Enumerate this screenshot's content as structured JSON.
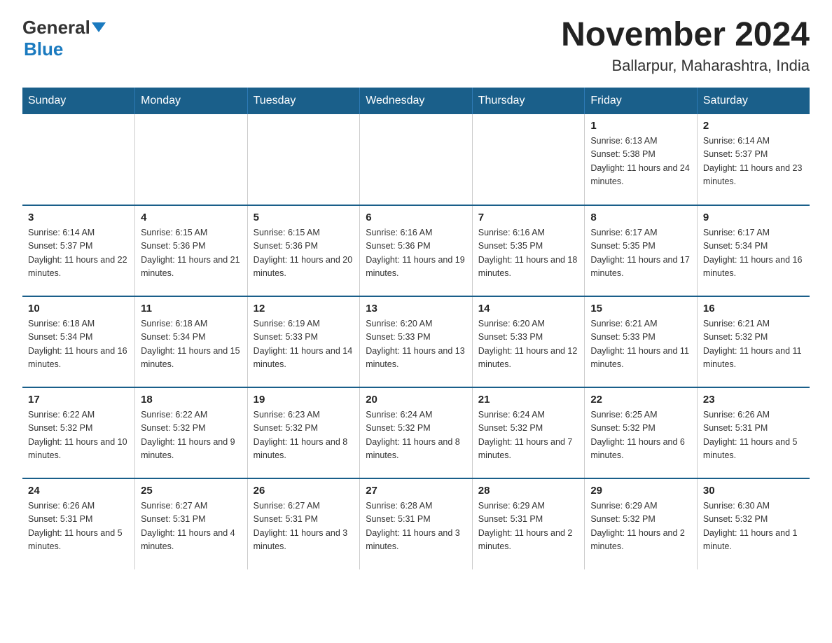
{
  "header": {
    "logo_general": "General",
    "logo_blue": "Blue",
    "title": "November 2024",
    "subtitle": "Ballarpur, Maharashtra, India"
  },
  "days_of_week": [
    "Sunday",
    "Monday",
    "Tuesday",
    "Wednesday",
    "Thursday",
    "Friday",
    "Saturday"
  ],
  "weeks": [
    [
      {
        "day": "",
        "info": ""
      },
      {
        "day": "",
        "info": ""
      },
      {
        "day": "",
        "info": ""
      },
      {
        "day": "",
        "info": ""
      },
      {
        "day": "",
        "info": ""
      },
      {
        "day": "1",
        "info": "Sunrise: 6:13 AM\nSunset: 5:38 PM\nDaylight: 11 hours and 24 minutes."
      },
      {
        "day": "2",
        "info": "Sunrise: 6:14 AM\nSunset: 5:37 PM\nDaylight: 11 hours and 23 minutes."
      }
    ],
    [
      {
        "day": "3",
        "info": "Sunrise: 6:14 AM\nSunset: 5:37 PM\nDaylight: 11 hours and 22 minutes."
      },
      {
        "day": "4",
        "info": "Sunrise: 6:15 AM\nSunset: 5:36 PM\nDaylight: 11 hours and 21 minutes."
      },
      {
        "day": "5",
        "info": "Sunrise: 6:15 AM\nSunset: 5:36 PM\nDaylight: 11 hours and 20 minutes."
      },
      {
        "day": "6",
        "info": "Sunrise: 6:16 AM\nSunset: 5:36 PM\nDaylight: 11 hours and 19 minutes."
      },
      {
        "day": "7",
        "info": "Sunrise: 6:16 AM\nSunset: 5:35 PM\nDaylight: 11 hours and 18 minutes."
      },
      {
        "day": "8",
        "info": "Sunrise: 6:17 AM\nSunset: 5:35 PM\nDaylight: 11 hours and 17 minutes."
      },
      {
        "day": "9",
        "info": "Sunrise: 6:17 AM\nSunset: 5:34 PM\nDaylight: 11 hours and 16 minutes."
      }
    ],
    [
      {
        "day": "10",
        "info": "Sunrise: 6:18 AM\nSunset: 5:34 PM\nDaylight: 11 hours and 16 minutes."
      },
      {
        "day": "11",
        "info": "Sunrise: 6:18 AM\nSunset: 5:34 PM\nDaylight: 11 hours and 15 minutes."
      },
      {
        "day": "12",
        "info": "Sunrise: 6:19 AM\nSunset: 5:33 PM\nDaylight: 11 hours and 14 minutes."
      },
      {
        "day": "13",
        "info": "Sunrise: 6:20 AM\nSunset: 5:33 PM\nDaylight: 11 hours and 13 minutes."
      },
      {
        "day": "14",
        "info": "Sunrise: 6:20 AM\nSunset: 5:33 PM\nDaylight: 11 hours and 12 minutes."
      },
      {
        "day": "15",
        "info": "Sunrise: 6:21 AM\nSunset: 5:33 PM\nDaylight: 11 hours and 11 minutes."
      },
      {
        "day": "16",
        "info": "Sunrise: 6:21 AM\nSunset: 5:32 PM\nDaylight: 11 hours and 11 minutes."
      }
    ],
    [
      {
        "day": "17",
        "info": "Sunrise: 6:22 AM\nSunset: 5:32 PM\nDaylight: 11 hours and 10 minutes."
      },
      {
        "day": "18",
        "info": "Sunrise: 6:22 AM\nSunset: 5:32 PM\nDaylight: 11 hours and 9 minutes."
      },
      {
        "day": "19",
        "info": "Sunrise: 6:23 AM\nSunset: 5:32 PM\nDaylight: 11 hours and 8 minutes."
      },
      {
        "day": "20",
        "info": "Sunrise: 6:24 AM\nSunset: 5:32 PM\nDaylight: 11 hours and 8 minutes."
      },
      {
        "day": "21",
        "info": "Sunrise: 6:24 AM\nSunset: 5:32 PM\nDaylight: 11 hours and 7 minutes."
      },
      {
        "day": "22",
        "info": "Sunrise: 6:25 AM\nSunset: 5:32 PM\nDaylight: 11 hours and 6 minutes."
      },
      {
        "day": "23",
        "info": "Sunrise: 6:26 AM\nSunset: 5:31 PM\nDaylight: 11 hours and 5 minutes."
      }
    ],
    [
      {
        "day": "24",
        "info": "Sunrise: 6:26 AM\nSunset: 5:31 PM\nDaylight: 11 hours and 5 minutes."
      },
      {
        "day": "25",
        "info": "Sunrise: 6:27 AM\nSunset: 5:31 PM\nDaylight: 11 hours and 4 minutes."
      },
      {
        "day": "26",
        "info": "Sunrise: 6:27 AM\nSunset: 5:31 PM\nDaylight: 11 hours and 3 minutes."
      },
      {
        "day": "27",
        "info": "Sunrise: 6:28 AM\nSunset: 5:31 PM\nDaylight: 11 hours and 3 minutes."
      },
      {
        "day": "28",
        "info": "Sunrise: 6:29 AM\nSunset: 5:31 PM\nDaylight: 11 hours and 2 minutes."
      },
      {
        "day": "29",
        "info": "Sunrise: 6:29 AM\nSunset: 5:32 PM\nDaylight: 11 hours and 2 minutes."
      },
      {
        "day": "30",
        "info": "Sunrise: 6:30 AM\nSunset: 5:32 PM\nDaylight: 11 hours and 1 minute."
      }
    ]
  ]
}
